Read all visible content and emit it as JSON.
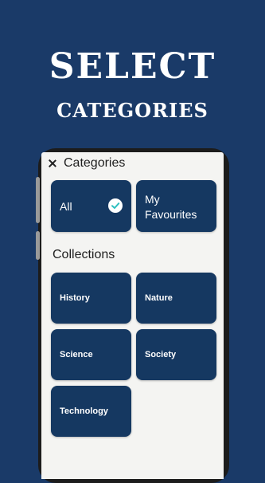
{
  "promo": {
    "headline": "SELECT",
    "subheadline": "CATEGORIES"
  },
  "app": {
    "title": "Categories",
    "close_icon": "close-icon",
    "top_tiles": [
      {
        "label": "All",
        "selected": true,
        "icon": "check-circle-icon"
      },
      {
        "label": "My Favourites",
        "line1": "My",
        "line2": "Favourites"
      }
    ],
    "collections_title": "Collections",
    "collections": [
      {
        "label": "History"
      },
      {
        "label": "Nature"
      },
      {
        "label": "Science"
      },
      {
        "label": "Society"
      },
      {
        "label": "Technology"
      }
    ]
  },
  "colors": {
    "background": "#1a3a68",
    "tile": "#153861",
    "screen": "#f4f4f2",
    "check": "#2ec0c0"
  }
}
